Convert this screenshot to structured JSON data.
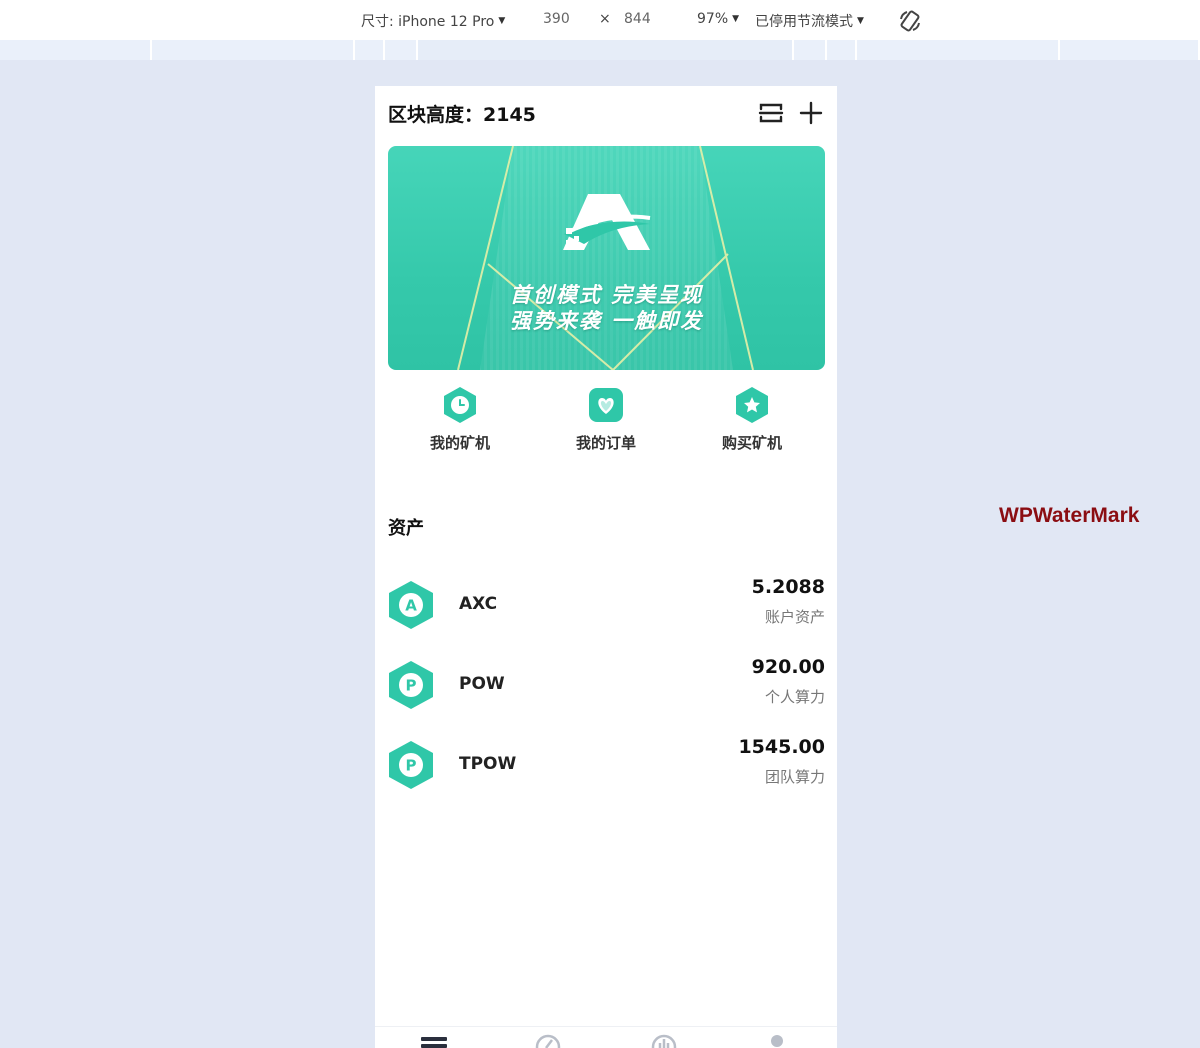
{
  "devtools": {
    "device_label": "尺寸: iPhone 12 Pro",
    "width": "390",
    "times": "×",
    "height": "844",
    "zoom": "97%",
    "throttle": "已停用节流模式"
  },
  "app": {
    "block_height_label": "区块高度：2145",
    "banner": {
      "slogan_line1": "首创模式  完美呈现",
      "slogan_line2": "强势来袭  一触即发",
      "logo_letter": "A"
    },
    "quick_actions": [
      {
        "label": "我的矿机",
        "icon": "clock-icon"
      },
      {
        "label": "我的订单",
        "icon": "heart-icon"
      },
      {
        "label": "购买矿机",
        "icon": "star-icon"
      }
    ],
    "assets_title": "资产",
    "assets": [
      {
        "symbol": "AXC",
        "letter": "A",
        "value": "5.2088",
        "caption": "账户资产"
      },
      {
        "symbol": "POW",
        "letter": "P",
        "value": "920.00",
        "caption": "个人算力"
      },
      {
        "symbol": "TPOW",
        "letter": "P",
        "value": "1545.00",
        "caption": "团队算力"
      }
    ]
  },
  "watermark": "WPWaterMark",
  "colors": {
    "accent": "#2fc7a8",
    "page_bg": "#e1e7f4",
    "watermark": "#8b0d12"
  }
}
